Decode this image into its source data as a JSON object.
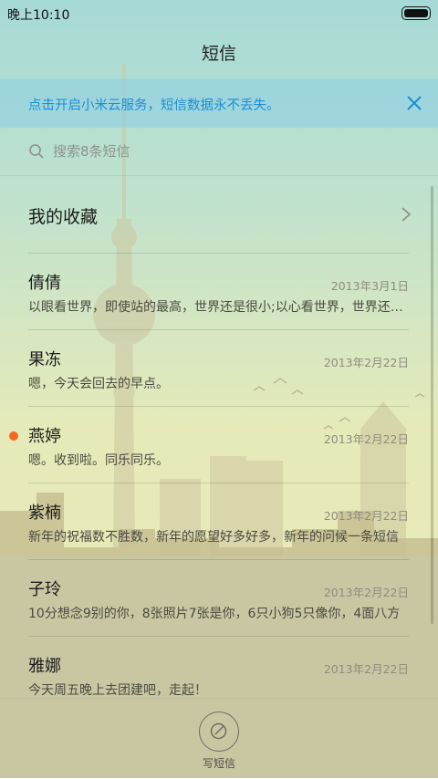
{
  "status_bar": {
    "time": "晚上10:10"
  },
  "header": {
    "title": "短信"
  },
  "banner": {
    "text": "点击开启小米云服务，短信数据永不丢失。"
  },
  "search": {
    "placeholder": "搜索8条短信"
  },
  "favorites": {
    "label": "我的收藏"
  },
  "conversations": [
    {
      "name": "倩倩",
      "date": "2013年3月1日",
      "preview": "以眼看世界，即使站的最高，世界还是很小;以心看世界，世界还很大",
      "unread": false
    },
    {
      "name": "果冻",
      "date": "2013年2月22日",
      "preview": "嗯，今天会回去的早点。",
      "unread": false
    },
    {
      "name": "燕婷",
      "date": "2013年2月22日",
      "preview": "嗯。收到啦。同乐同乐。",
      "unread": true
    },
    {
      "name": "紫楠",
      "date": "2013年2月22日",
      "preview": "新年的祝福数不胜数，新年的愿望好多好多，新年的问候一条短信",
      "unread": false
    },
    {
      "name": "子玲",
      "date": "2013年2月22日",
      "preview": "10分想念9别的你，8张照片7张是你，6只小狗5只像你，4面八方",
      "unread": false
    },
    {
      "name": "雅娜",
      "date": "2013年2月22日",
      "preview": "今天周五晚上去团建吧，走起！",
      "unread": false
    }
  ],
  "bottom_bar": {
    "compose_label": "写短信"
  },
  "colors": {
    "accent": "#1a8fd6",
    "unread_dot": "#f26722"
  },
  "icons": [
    "battery-icon",
    "close-icon",
    "search-icon",
    "chevron-right-icon",
    "compose-icon"
  ]
}
